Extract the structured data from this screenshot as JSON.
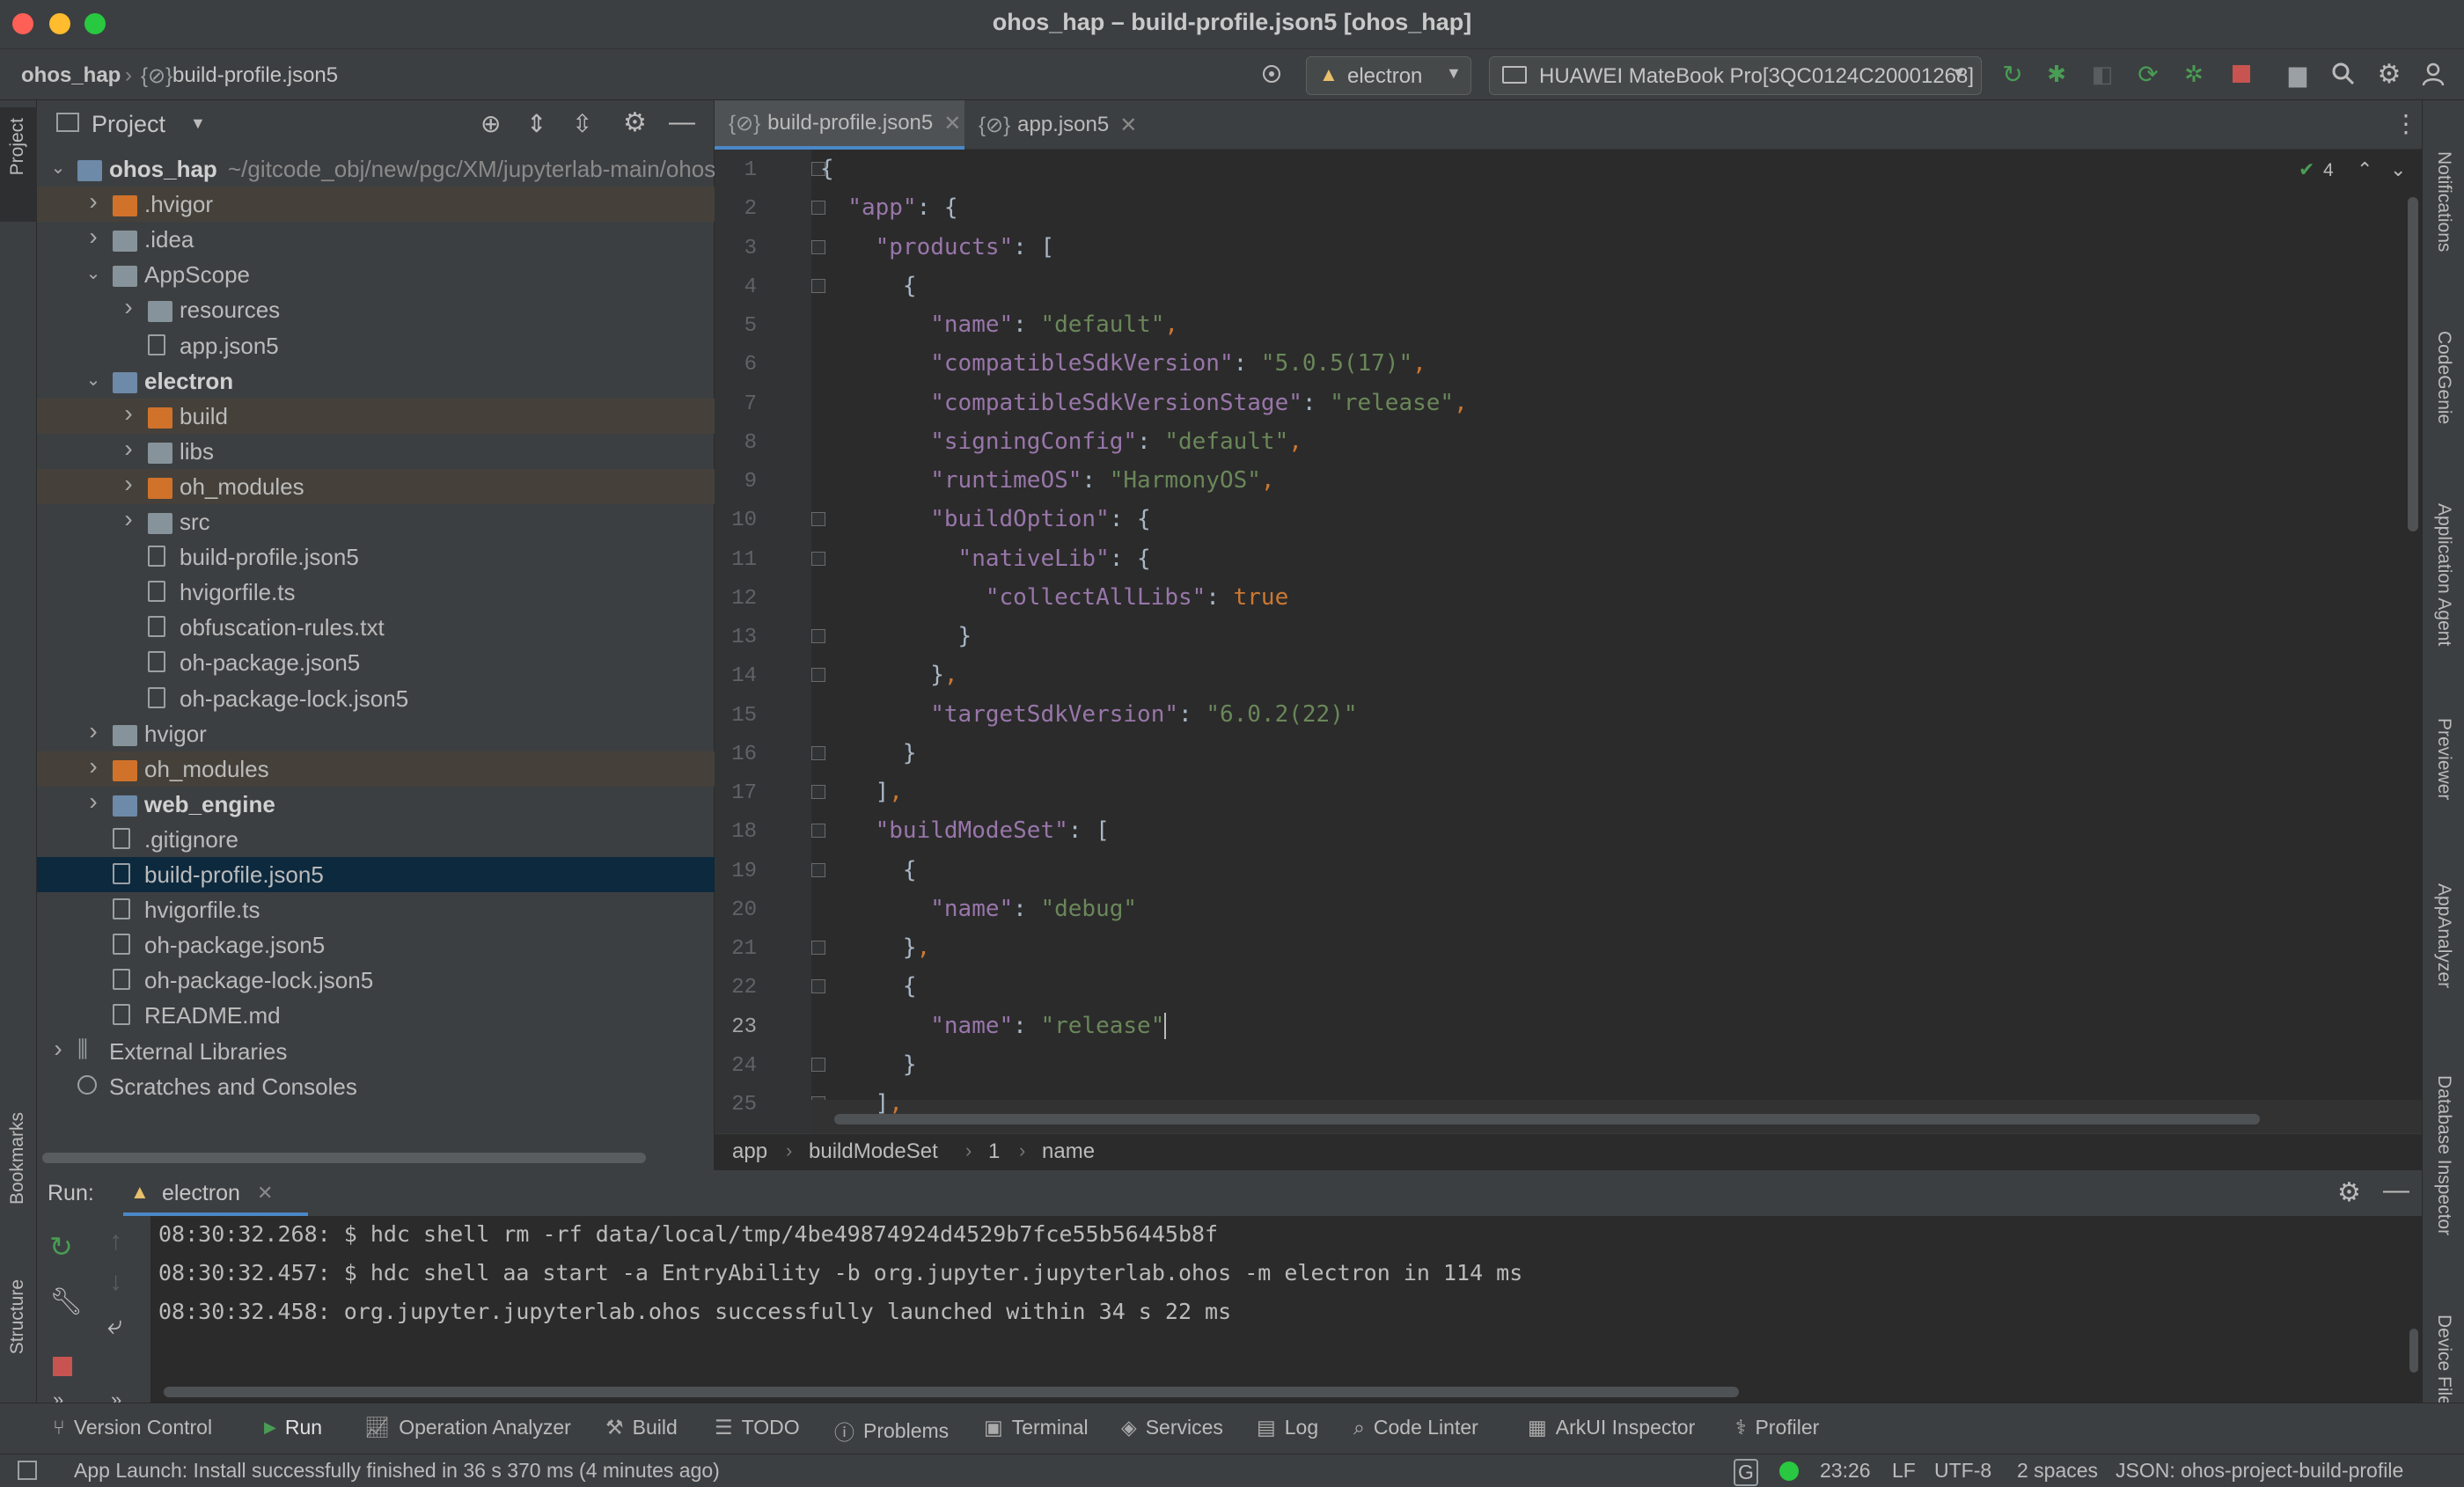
{
  "window": {
    "title": "ohos_hap – build-profile.json5 [ohos_hap]"
  },
  "nav": {
    "project": "ohos_hap",
    "file": "build-profile.json5",
    "run_config": "electron",
    "device": "HUAWEI MateBook Pro[3QC0124C20001268]"
  },
  "left_strip": {
    "project": "Project",
    "bookmarks": "Bookmarks",
    "structure": "Structure"
  },
  "right_strip": [
    "Notifications",
    "CodeGenie",
    "Application Agent",
    "Previewer",
    "AppAnalyzer",
    "Database Inspector",
    "Device File"
  ],
  "project_panel": {
    "title": "Project"
  },
  "tree": [
    {
      "label": "ohos_hap",
      "path": "~/gitcode_obj/new/pgc/XM/jupyterlab-main/ohos",
      "bold": true,
      "depth": 0,
      "kind": "folder-blue",
      "arrow": "open"
    },
    {
      "label": ".hvigor",
      "depth": 1,
      "kind": "folder-orange",
      "arrow": "closed",
      "tint": true
    },
    {
      "label": ".idea",
      "depth": 1,
      "kind": "folder",
      "arrow": "closed"
    },
    {
      "label": "AppScope",
      "depth": 1,
      "kind": "folder",
      "arrow": "open"
    },
    {
      "label": "resources",
      "depth": 2,
      "kind": "folder",
      "arrow": "closed"
    },
    {
      "label": "app.json5",
      "depth": 2,
      "kind": "file"
    },
    {
      "label": "electron",
      "depth": 1,
      "kind": "folder-blue",
      "arrow": "open",
      "bold": true
    },
    {
      "label": "build",
      "depth": 2,
      "kind": "folder-orange",
      "arrow": "closed",
      "tint": true
    },
    {
      "label": "libs",
      "depth": 2,
      "kind": "folder",
      "arrow": "closed"
    },
    {
      "label": "oh_modules",
      "depth": 2,
      "kind": "folder-orange",
      "arrow": "closed",
      "tint": true
    },
    {
      "label": "src",
      "depth": 2,
      "kind": "folder",
      "arrow": "closed"
    },
    {
      "label": "build-profile.json5",
      "depth": 2,
      "kind": "file"
    },
    {
      "label": "hvigorfile.ts",
      "depth": 2,
      "kind": "file"
    },
    {
      "label": "obfuscation-rules.txt",
      "depth": 2,
      "kind": "file"
    },
    {
      "label": "oh-package.json5",
      "depth": 2,
      "kind": "file"
    },
    {
      "label": "oh-package-lock.json5",
      "depth": 2,
      "kind": "file"
    },
    {
      "label": "hvigor",
      "depth": 1,
      "kind": "folder",
      "arrow": "closed"
    },
    {
      "label": "oh_modules",
      "depth": 1,
      "kind": "folder-orange",
      "arrow": "closed",
      "tint": true
    },
    {
      "label": "web_engine",
      "depth": 1,
      "kind": "folder-blue",
      "arrow": "closed",
      "bold": true
    },
    {
      "label": ".gitignore",
      "depth": 1,
      "kind": "file"
    },
    {
      "label": "build-profile.json5",
      "depth": 1,
      "kind": "file",
      "selected": true
    },
    {
      "label": "hvigorfile.ts",
      "depth": 1,
      "kind": "file"
    },
    {
      "label": "oh-package.json5",
      "depth": 1,
      "kind": "file"
    },
    {
      "label": "oh-package-lock.json5",
      "depth": 1,
      "kind": "file"
    },
    {
      "label": "README.md",
      "depth": 1,
      "kind": "file"
    },
    {
      "label": "External Libraries",
      "depth": 0,
      "kind": "lib",
      "arrow": "closed"
    },
    {
      "label": "Scratches and Consoles",
      "depth": 0,
      "kind": "scratch"
    }
  ],
  "editor": {
    "tabs": [
      {
        "label": "build-profile.json5",
        "active": true
      },
      {
        "label": "app.json5",
        "active": false
      }
    ],
    "inspection_count": "4",
    "current_line": 23,
    "lines": [
      [
        [
          "p",
          "{"
        ]
      ],
      [
        [
          "p",
          "  "
        ],
        [
          "k",
          "\"app\""
        ],
        [
          "p",
          ": {"
        ]
      ],
      [
        [
          "p",
          "    "
        ],
        [
          "k",
          "\"products\""
        ],
        [
          "p",
          ": ["
        ]
      ],
      [
        [
          "p",
          "      {"
        ]
      ],
      [
        [
          "p",
          "        "
        ],
        [
          "k",
          "\"name\""
        ],
        [
          "p",
          ": "
        ],
        [
          "s",
          "\"default\""
        ],
        [
          "b",
          ","
        ]
      ],
      [
        [
          "p",
          "        "
        ],
        [
          "k",
          "\"compatibleSdkVersion\""
        ],
        [
          "p",
          ": "
        ],
        [
          "s",
          "\"5.0.5(17)\""
        ],
        [
          "b",
          ","
        ]
      ],
      [
        [
          "p",
          "        "
        ],
        [
          "k",
          "\"compatibleSdkVersionStage\""
        ],
        [
          "p",
          ": "
        ],
        [
          "s",
          "\"release\""
        ],
        [
          "b",
          ","
        ]
      ],
      [
        [
          "p",
          "        "
        ],
        [
          "k",
          "\"signingConfig\""
        ],
        [
          "p",
          ": "
        ],
        [
          "s",
          "\"default\""
        ],
        [
          "b",
          ","
        ]
      ],
      [
        [
          "p",
          "        "
        ],
        [
          "k",
          "\"runtimeOS\""
        ],
        [
          "p",
          ": "
        ],
        [
          "s",
          "\"HarmonyOS\""
        ],
        [
          "b",
          ","
        ]
      ],
      [
        [
          "p",
          "        "
        ],
        [
          "k",
          "\"buildOption\""
        ],
        [
          "p",
          ": {"
        ]
      ],
      [
        [
          "p",
          "          "
        ],
        [
          "k",
          "\"nativeLib\""
        ],
        [
          "p",
          ": {"
        ]
      ],
      [
        [
          "p",
          "            "
        ],
        [
          "k",
          "\"collectAllLibs\""
        ],
        [
          "p",
          ": "
        ],
        [
          "b",
          "true"
        ]
      ],
      [
        [
          "p",
          "          }"
        ]
      ],
      [
        [
          "p",
          "        }"
        ],
        [
          "b",
          ","
        ]
      ],
      [
        [
          "p",
          "        "
        ],
        [
          "k",
          "\"targetSdkVersion\""
        ],
        [
          "p",
          ": "
        ],
        [
          "s",
          "\"6.0.2(22)\""
        ]
      ],
      [
        [
          "p",
          "      }"
        ]
      ],
      [
        [
          "p",
          "    ]"
        ],
        [
          "b",
          ","
        ]
      ],
      [
        [
          "p",
          "    "
        ],
        [
          "k",
          "\"buildModeSet\""
        ],
        [
          "p",
          ": ["
        ]
      ],
      [
        [
          "p",
          "      {"
        ]
      ],
      [
        [
          "p",
          "        "
        ],
        [
          "k",
          "\"name\""
        ],
        [
          "p",
          ": "
        ],
        [
          "s",
          "\"debug\""
        ]
      ],
      [
        [
          "p",
          "      }"
        ],
        [
          "b",
          ","
        ]
      ],
      [
        [
          "p",
          "      {"
        ]
      ],
      [
        [
          "p",
          "        "
        ],
        [
          "k",
          "\"name\""
        ],
        [
          "p",
          ": "
        ],
        [
          "s",
          "\"release\""
        ]
      ],
      [
        [
          "p",
          "      }"
        ]
      ],
      [
        [
          "p",
          "    ]"
        ],
        [
          "b",
          ","
        ]
      ]
    ],
    "breadcrumb": [
      "app",
      "buildModeSet",
      "1",
      "name"
    ]
  },
  "run": {
    "label": "Run:",
    "tab": "electron",
    "log": [
      "08:30:32.268: $ hdc shell rm -rf data/local/tmp/4be49874924d4529b7fce55b56445b8f",
      "08:30:32.457: $ hdc shell aa start -a EntryAbility -b org.jupyter.jupyterlab.ohos -m electron in 114 ms",
      "08:30:32.458: org.jupyter.jupyterlab.ohos successfully launched within 34 s 22 ms"
    ]
  },
  "bottom_tabs": [
    {
      "label": "Version Control",
      "icon": "branch-icon"
    },
    {
      "label": "Run",
      "icon": "play-icon",
      "active": true
    },
    {
      "label": "Operation Analyzer",
      "icon": "chart-icon"
    },
    {
      "label": "Build",
      "icon": "hammer-icon"
    },
    {
      "label": "TODO",
      "icon": "list-icon"
    },
    {
      "label": "Problems",
      "icon": "info-icon"
    },
    {
      "label": "Terminal",
      "icon": "terminal-icon"
    },
    {
      "label": "Services",
      "icon": "services-icon"
    },
    {
      "label": "Log",
      "icon": "log-icon"
    },
    {
      "label": "Code Linter",
      "icon": "linter-icon"
    },
    {
      "label": "ArkUI Inspector",
      "icon": "inspector-icon"
    },
    {
      "label": "Profiler",
      "icon": "profiler-icon"
    }
  ],
  "status": {
    "message": "App Launch: Install successfully finished in 36 s 370 ms (4 minutes ago)",
    "position": "23:26",
    "line_sep": "LF",
    "encoding": "UTF-8",
    "indent": "2 spaces",
    "schema": "JSON: ohos-project-build-profile"
  },
  "colors": {
    "keyword": "#9876aa",
    "string": "#6a8759",
    "punct": "#a9b7c6",
    "literal": "#cc7832",
    "selection": "#0d293e",
    "accent": "#4a88c7"
  }
}
